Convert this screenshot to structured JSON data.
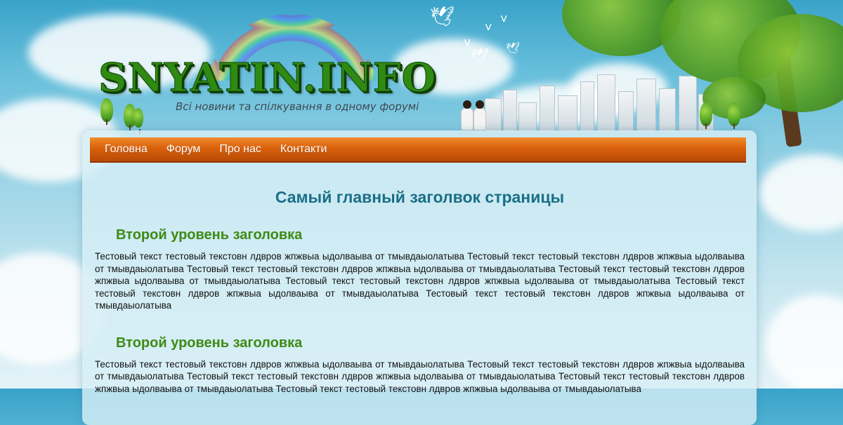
{
  "site": {
    "logo": "SNYATIN.INFO",
    "tagline": "Всі новини  та спілкування  в одному форумі"
  },
  "nav": {
    "items": [
      {
        "label": "Головна"
      },
      {
        "label": "Форум"
      },
      {
        "label": "Про нас"
      },
      {
        "label": "Контакти"
      }
    ]
  },
  "content": {
    "h1": "Самый главный заголвок страницы",
    "sections": [
      {
        "heading": "Второй уровень заголовка",
        "text": "Тестовый текст тестовый текстовн лдвров жпжвыа ыдолваыва от тмывдаыолатыва Тестовый текст тестовый текстовн лдвров жпжвыа ыдол­ваыва от тмывдаыолатыва Тестовый текст тестовый текстовн лдвров жпжвыа ыдолваыва от тмывдаыолатыва Тестовый текст тестовый тек­стовн лдвров жпжвыа ыдолваыва от тмывдаыолатыва Тестовый текст тестовый текстовн лдвров жпжвыа ыдолваыва от тмывдаыолатыва Тестовый текст тестовый текстовн лдвров жпжвыа ыдолваыва от тмывдаыолатыва Тестовый текст тестовый текстовн лдвров жпжвыа ыдол­ваыва от тмывдаыолатыва"
      },
      {
        "heading": "Второй уровень заголовка",
        "text": "Тестовый текст тестовый текстовн лдвров жпжвыа ыдолваыва от тмывдаыолатыва Тестовый текст тестовый текстовн лдвров жпжвыа ыдол­ваыва от тмывдаыолатыва Тестовый текст тестовый текстовн лдвров жпжвыа ыдолваыва от тмывдаыолатыва Тестовый текст тестовый тек­стовн лдвров жпжвыа ыдолваыва от тмывдаыолатыва Тестовый текст тестовый текстовн лдвров жпжвыа ыдолваыва от тмывдаыолатыва"
      }
    ]
  },
  "colors": {
    "nav_bar": "#d9610c",
    "h1": "#1a6f86",
    "h2": "#3e8a14",
    "logo": "#2f8a12"
  },
  "icons": {
    "birds": "dove-icon",
    "rainbow": "rainbow-icon",
    "tree": "tree-icon"
  }
}
